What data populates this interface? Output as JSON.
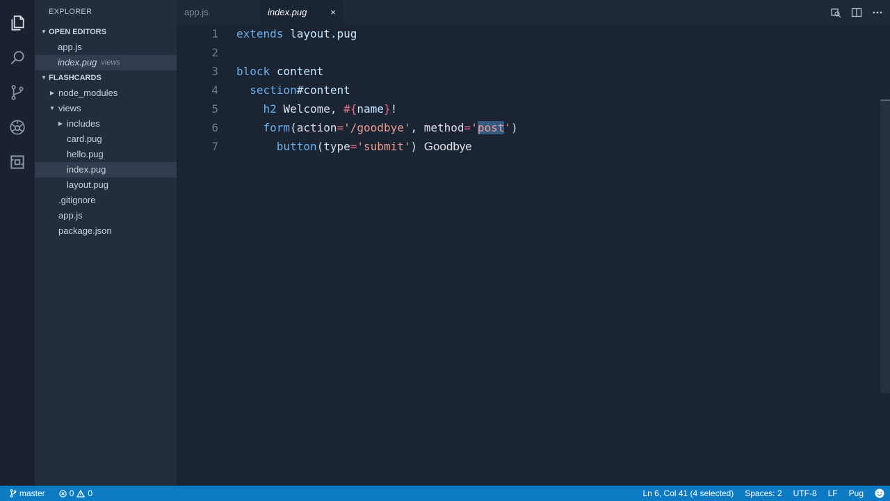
{
  "sidebar": {
    "title": "EXPLORER",
    "open_editors": {
      "header": "OPEN EDITORS",
      "items": [
        {
          "label": "app.js"
        },
        {
          "label": "index.pug",
          "desc": "views"
        }
      ]
    },
    "project": {
      "header": "FLASHCARDS",
      "items": [
        {
          "label": "node_modules"
        },
        {
          "label": "views"
        },
        {
          "label": "includes"
        },
        {
          "label": "card.pug"
        },
        {
          "label": "hello.pug"
        },
        {
          "label": "index.pug"
        },
        {
          "label": "layout.pug"
        },
        {
          "label": ".gitignore"
        },
        {
          "label": "app.js"
        },
        {
          "label": "package.json"
        }
      ]
    }
  },
  "tabs": [
    {
      "label": "app.js"
    },
    {
      "label": "index.pug",
      "close": "×"
    }
  ],
  "editor": {
    "line_numbers": [
      "1",
      "2",
      "3",
      "4",
      "5",
      "6",
      "7"
    ],
    "line1": {
      "kw": "extends",
      "arg": "layout.pug"
    },
    "line3": {
      "kw": "block",
      "arg": "content"
    },
    "line4": {
      "tag": "section",
      "id": "#content"
    },
    "line5": {
      "tag": "h2",
      "text": "Welcome,",
      "interp_open": "#{",
      "var": "name",
      "interp_close": "}",
      "bang": "!"
    },
    "line6": {
      "tag": "form",
      "p1": "(",
      "a1": "action",
      "eq1": "=",
      "s1": "'/goodbye'",
      "comma": ",",
      "a2": "method",
      "eq2": "=",
      "q1": "'",
      "sel": "post",
      "q2": "'",
      "p2": ")"
    },
    "line7": {
      "tag": "button",
      "p1": "(",
      "a1": "type",
      "eq1": "=",
      "s1": "'submit'",
      "p2": ")",
      "text": "Goodbye"
    }
  },
  "status": {
    "branch": "master",
    "errors": "0",
    "warnings": "0",
    "position": "Ln 6, Col 41 (4 selected)",
    "spaces": "Spaces: 2",
    "encoding": "UTF-8",
    "eol": "LF",
    "language": "Pug"
  }
}
